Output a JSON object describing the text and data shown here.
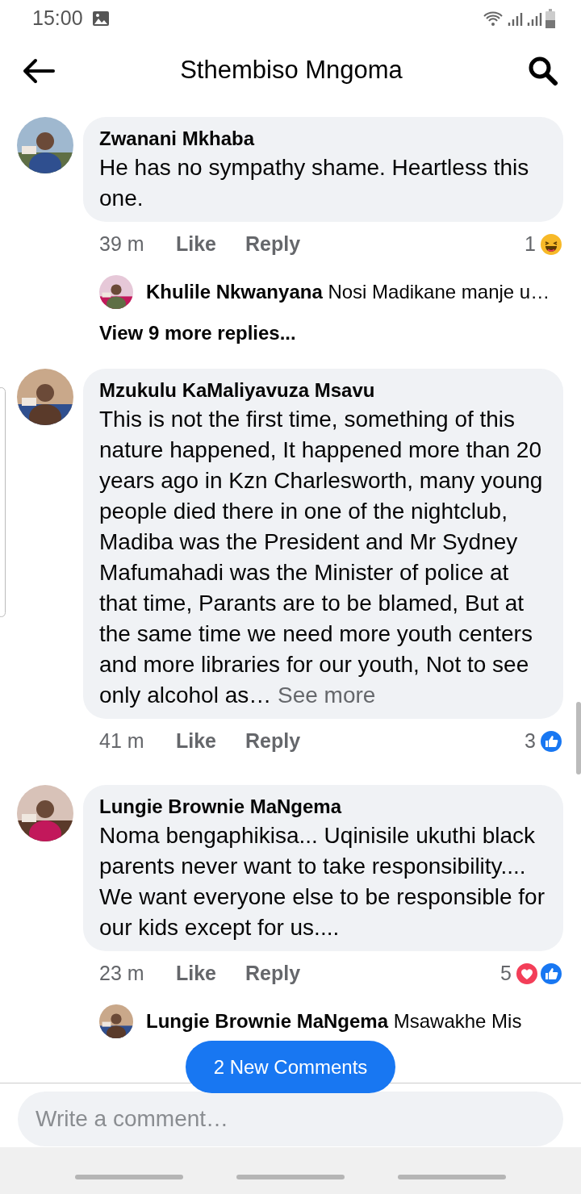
{
  "status_bar": {
    "time": "15:00"
  },
  "header": {
    "title": "Sthembiso Mngoma"
  },
  "comments": [
    {
      "author": "Zwanani Mkhaba",
      "text": "He has no sympathy shame. Heartless this one.",
      "time": "39 m",
      "like": "Like",
      "reply": "Reply",
      "reaction_count": "1",
      "reactions": [
        {
          "kind": "haha"
        }
      ],
      "replies": [
        {
          "author": "Khulile Nkwanyana",
          "text": "Nosi Madikane manje u…"
        }
      ],
      "view_more": "View 9 more replies..."
    },
    {
      "author": "Mzukulu KaMaliyavuza Msavu",
      "text": "This is not the first time, something of this nature happened, It happened more than 20 years ago in Kzn Charlesworth, many young people died there in one of the nightclub, Madiba was the President and Mr Sydney Mafumahadi was the Minister of police at that time, Parants are to be blamed, But at the same time we need more youth centers and more libraries for our youth, Not to see only alcohol as…",
      "see_more": "See more",
      "time": "41 m",
      "like": "Like",
      "reply": "Reply",
      "reaction_count": "3",
      "reactions": [
        {
          "kind": "like"
        }
      ]
    },
    {
      "author": "Lungie Brownie MaNgema",
      "text": "Noma bengaphikisa... Uqinisile ukuthi black parents never want to take responsibility.... We want everyone else to be responsible for our kids except for us....",
      "time": "23 m",
      "like": "Like",
      "reply": "Reply",
      "reaction_count": "5",
      "reactions": [
        {
          "kind": "love"
        },
        {
          "kind": "like"
        }
      ],
      "replies": [
        {
          "author": "Lungie Brownie MaNgema",
          "text": "Msawakhe Mis"
        }
      ]
    }
  ],
  "new_comments_button": "2 New Comments",
  "composer": {
    "placeholder": "Write a comment…"
  }
}
